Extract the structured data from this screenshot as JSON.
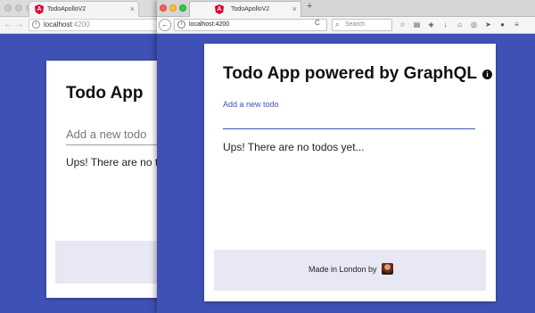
{
  "back_window": {
    "tab_title": "TodoApolloV2",
    "url_host": "localhost",
    "url_port": ":4200",
    "app_title": "Todo App",
    "input_placeholder": "Add a new todo",
    "empty_message": "Ups! There are no todos"
  },
  "front_window": {
    "tab_title": "TodoApolloV2",
    "url": "localhost:4200",
    "search_placeholder": "Search",
    "app": {
      "title": "Todo App powered by GraphQL",
      "input_label": "Add a new todo",
      "input_value": "",
      "empty_message": "Ups! There are no todos yet...",
      "footer_text": "Made in London by"
    }
  },
  "icons": {
    "angular": "A",
    "info": "i",
    "close": "×",
    "new_tab": "+",
    "back": "←",
    "forward": "→",
    "reload": "C",
    "search": "⌕",
    "toolbar": [
      "☆",
      "▤",
      "◈",
      "↓",
      "⌂",
      "◎",
      "➤",
      "●",
      "≡"
    ]
  },
  "colors": {
    "page_background": "#3f51b5",
    "accent": "#3f51b5",
    "angular_red": "#dd0031",
    "footer_background": "#e8e8f4"
  }
}
